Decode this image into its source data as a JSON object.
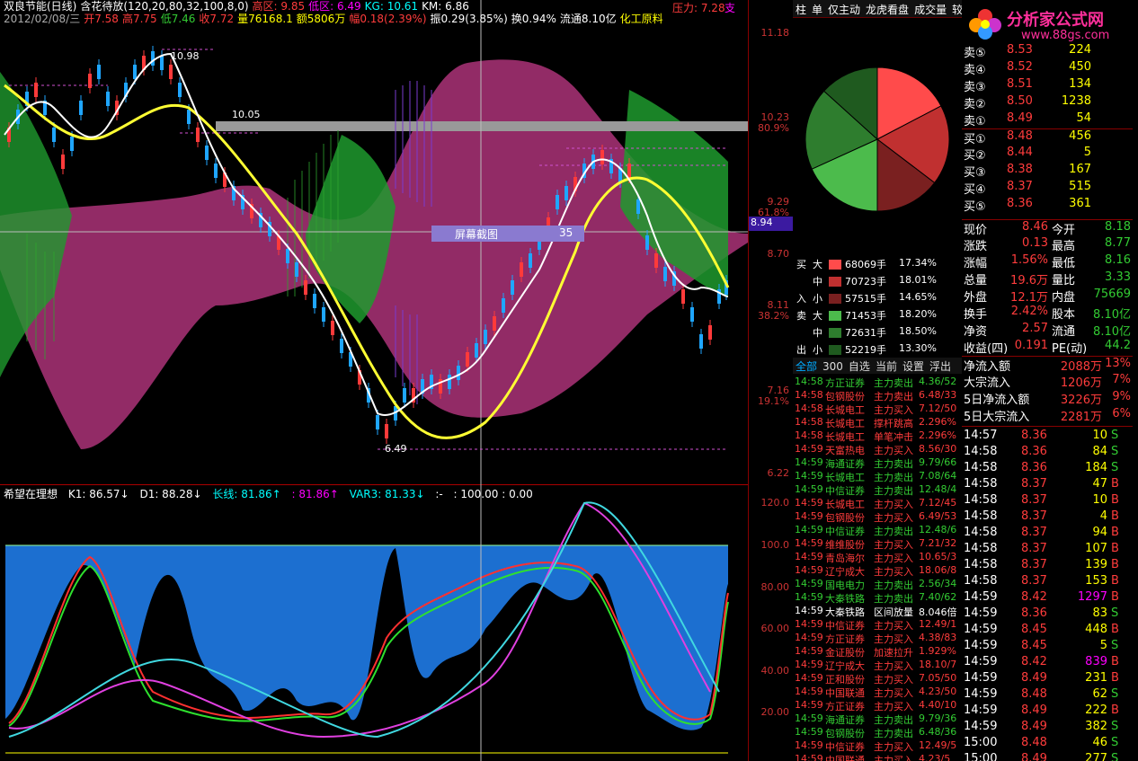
{
  "header": {
    "stock_name": "双良节能(日线)",
    "indicator": "含花待放(120,20,80,32,100,8,0)",
    "high_zone": "高区: 9.85",
    "low_zone": "低区: 6.49",
    "kg": "KG: 10.61",
    "km": "KM: 6.86",
    "pressure": "压力: 7.28",
    "support": "支",
    "date": "2012/02/08/三",
    "open": "开7.58",
    "high": "高7.75",
    "low": "低7.46",
    "close": "收7.72",
    "volume": "量76168.1",
    "amount": "额5806万",
    "amp": "幅0.18(2.39%)",
    "swing": "振0.29(3.85%)",
    "turnover": "换0.94%",
    "float": "流通8.10亿",
    "sector": "化工原料"
  },
  "chart_labels": {
    "max_label": "10.98",
    "min_label": "6.49",
    "level_label": "10.05",
    "overlay_box": "屏幕截图",
    "overlay_num": "35",
    "cursor_price": "8.94"
  },
  "price_axis": [
    "11.18",
    "10.23",
    "80.9%",
    "9.29",
    "61.8%",
    "8.70",
    "8.11",
    "38.2%",
    "7.16",
    "19.1%",
    "6.22"
  ],
  "sub_header": {
    "name": "希望在理想",
    "k1": "K1: 86.57↓",
    "d1": "D1: 88.28↓",
    "long": "长线: 81.86↑",
    "long2": ": 81.86↑",
    "var3": "VAR3: 81.33↓",
    "dash": ":-",
    "vals": ": 100.00 : 0.00"
  },
  "sub_axis": [
    "120.0",
    "100.0",
    "80.00",
    "60.00",
    "40.00",
    "20.00"
  ],
  "tabs": [
    "柱",
    "单",
    "仅主动",
    "龙虎看盘",
    "成交量",
    "较"
  ],
  "logo": {
    "title": "分析家公式网",
    "url": "www.88gs.com"
  },
  "pie_colors": [
    "#ff4b4b",
    "#c03030",
    "#7a2020",
    "#1f5a1f",
    "#2e7d2e",
    "#4cbb4c"
  ],
  "flow": [
    {
      "side": "买",
      "size": "大",
      "vol": "68069手",
      "pct": "17.34%",
      "color": "#ff4b4b"
    },
    {
      "side": "",
      "size": "中",
      "vol": "70723手",
      "pct": "18.01%",
      "color": "#c03030"
    },
    {
      "side": "入",
      "size": "小",
      "vol": "57515手",
      "pct": "14.65%",
      "color": "#7a2020"
    },
    {
      "side": "卖",
      "size": "大",
      "vol": "71453手",
      "pct": "18.20%",
      "color": "#4cbb4c"
    },
    {
      "side": "",
      "size": "中",
      "vol": "72631手",
      "pct": "18.50%",
      "color": "#2e7d2e"
    },
    {
      "side": "出",
      "size": "小",
      "vol": "52219手",
      "pct": "13.30%",
      "color": "#1f5a1f"
    }
  ],
  "list_tabs": [
    "全部",
    "300",
    "自选",
    "当前",
    "设置",
    "浮出"
  ],
  "ticks": [
    {
      "t": "14:58",
      "n": "方正证券",
      "a": "主力卖出",
      "v": "4.36/52",
      "c": "green"
    },
    {
      "t": "14:58",
      "n": "包钢股份",
      "a": "主力卖出",
      "v": "6.48/33",
      "c": "red"
    },
    {
      "t": "14:58",
      "n": "长城电工",
      "a": "主力买入",
      "v": "7.12/50",
      "c": "red"
    },
    {
      "t": "14:58",
      "n": "长城电工",
      "a": "撑杆跳高",
      "v": "2.296%",
      "c": "red"
    },
    {
      "t": "14:58",
      "n": "长城电工",
      "a": "单笔冲击",
      "v": "2.296%",
      "c": "red"
    },
    {
      "t": "14:59",
      "n": "天富热电",
      "a": "主力买入",
      "v": "8.56/30",
      "c": "red"
    },
    {
      "t": "14:59",
      "n": "海通证券",
      "a": "主力卖出",
      "v": "9.79/66",
      "c": "green"
    },
    {
      "t": "14:59",
      "n": "长城电工",
      "a": "主力卖出",
      "v": "7.08/64",
      "c": "green"
    },
    {
      "t": "14:59",
      "n": "中信证券",
      "a": "主力卖出",
      "v": "12.48/4",
      "c": "green"
    },
    {
      "t": "14:59",
      "n": "长城电工",
      "a": "主力买入",
      "v": "7.12/45",
      "c": "red"
    },
    {
      "t": "14:59",
      "n": "包钢股份",
      "a": "主力买入",
      "v": "6.49/53",
      "c": "red"
    },
    {
      "t": "14:59",
      "n": "中信证券",
      "a": "主力卖出",
      "v": "12.48/6",
      "c": "green"
    },
    {
      "t": "14:59",
      "n": "维维股份",
      "a": "主力买入",
      "v": "7.21/32",
      "c": "red"
    },
    {
      "t": "14:59",
      "n": "青岛海尔",
      "a": "主力买入",
      "v": "10.65/3",
      "c": "red"
    },
    {
      "t": "14:59",
      "n": "辽宁成大",
      "a": "主力买入",
      "v": "18.06/8",
      "c": "red"
    },
    {
      "t": "14:59",
      "n": "国电电力",
      "a": "主力卖出",
      "v": "2.56/34",
      "c": "green"
    },
    {
      "t": "14:59",
      "n": "大秦铁路",
      "a": "主力卖出",
      "v": "7.40/62",
      "c": "green"
    },
    {
      "t": "14:59",
      "n": "大秦铁路",
      "a": "区间放量",
      "v": "8.046倍",
      "c": "white"
    },
    {
      "t": "14:59",
      "n": "中信证券",
      "a": "主力买入",
      "v": "12.49/1",
      "c": "red"
    },
    {
      "t": "14:59",
      "n": "方正证券",
      "a": "主力买入",
      "v": "4.38/83",
      "c": "red"
    },
    {
      "t": "14:59",
      "n": "金证股份",
      "a": "加速拉升",
      "v": "1.929%",
      "c": "red"
    },
    {
      "t": "14:59",
      "n": "辽宁成大",
      "a": "主力买入",
      "v": "18.10/7",
      "c": "red"
    },
    {
      "t": "14:59",
      "n": "正和股份",
      "a": "主力买入",
      "v": "7.05/50",
      "c": "red"
    },
    {
      "t": "14:59",
      "n": "中国联通",
      "a": "主力买入",
      "v": "4.23/50",
      "c": "red"
    },
    {
      "t": "14:59",
      "n": "方正证券",
      "a": "主力买入",
      "v": "4.40/10",
      "c": "red"
    },
    {
      "t": "14:59",
      "n": "海通证券",
      "a": "主力卖出",
      "v": "9.79/36",
      "c": "green"
    },
    {
      "t": "14:59",
      "n": "包钢股份",
      "a": "主力卖出",
      "v": "6.48/36",
      "c": "green"
    },
    {
      "t": "14:59",
      "n": "中信证券",
      "a": "主力买入",
      "v": "12.49/5",
      "c": "red"
    },
    {
      "t": "14:59",
      "n": "中国联通",
      "a": "主力买入",
      "v": "4.23/5",
      "c": "red"
    }
  ],
  "order_book": [
    {
      "l": "卖⑤",
      "p": "8.53",
      "v": "224"
    },
    {
      "l": "卖④",
      "p": "8.52",
      "v": "450"
    },
    {
      "l": "卖③",
      "p": "8.51",
      "v": "134"
    },
    {
      "l": "卖②",
      "p": "8.50",
      "v": "1238"
    },
    {
      "l": "卖①",
      "p": "8.49",
      "v": "54"
    },
    {
      "l": "买①",
      "p": "8.48",
      "v": "456"
    },
    {
      "l": "买②",
      "p": "8.44",
      "v": "5"
    },
    {
      "l": "买③",
      "p": "8.38",
      "v": "167"
    },
    {
      "l": "买④",
      "p": "8.37",
      "v": "515"
    },
    {
      "l": "买⑤",
      "p": "8.36",
      "v": "361"
    }
  ],
  "stats": [
    {
      "l": "现价",
      "v": "8.46",
      "l2": "今开",
      "v2": "8.18"
    },
    {
      "l": "涨跌",
      "v": "0.13",
      "l2": "最高",
      "v2": "8.77"
    },
    {
      "l": "涨幅",
      "v": "1.56%",
      "l2": "最低",
      "v2": "8.16"
    },
    {
      "l": "总量",
      "v": "19.6万",
      "l2": "量比",
      "v2": "3.33"
    },
    {
      "l": "外盘",
      "v": "12.1万",
      "l2": "内盘",
      "v2": "75669"
    },
    {
      "l": "换手",
      "v": "2.42%",
      "l2": "股本",
      "v2": "8.10亿"
    },
    {
      "l": "净资",
      "v": "2.57",
      "l2": "流通",
      "v2": "8.10亿"
    },
    {
      "l": "收益(四)",
      "v": "0.191",
      "l2": "PE(动)",
      "v2": "44.2"
    }
  ],
  "fund_flow": [
    {
      "l": "净流入额",
      "v": "2088万",
      "p": "13%"
    },
    {
      "l": "大宗流入",
      "v": "1206万",
      "p": "7%"
    },
    {
      "l": "5日净流入额",
      "v": "3226万",
      "p": "9%"
    },
    {
      "l": "5日大宗流入",
      "v": "2281万",
      "p": "6%"
    }
  ],
  "trades": [
    {
      "t": "14:57",
      "p": "8.36",
      "v": "10",
      "s": "S"
    },
    {
      "t": "14:58",
      "p": "8.36",
      "v": "84",
      "s": "S"
    },
    {
      "t": "14:58",
      "p": "8.36",
      "v": "184",
      "s": "S"
    },
    {
      "t": "14:58",
      "p": "8.37",
      "v": "47",
      "s": "B"
    },
    {
      "t": "14:58",
      "p": "8.37",
      "v": "10",
      "s": "B"
    },
    {
      "t": "14:58",
      "p": "8.37",
      "v": "4",
      "s": "B"
    },
    {
      "t": "14:58",
      "p": "8.37",
      "v": "94",
      "s": "B"
    },
    {
      "t": "14:58",
      "p": "8.37",
      "v": "107",
      "s": "B"
    },
    {
      "t": "14:58",
      "p": "8.37",
      "v": "139",
      "s": "B"
    },
    {
      "t": "14:58",
      "p": "8.37",
      "v": "153",
      "s": "B"
    },
    {
      "t": "14:59",
      "p": "8.42",
      "v": "1297",
      "s": "B"
    },
    {
      "t": "14:59",
      "p": "8.36",
      "v": "83",
      "s": "S"
    },
    {
      "t": "14:59",
      "p": "8.45",
      "v": "448",
      "s": "B"
    },
    {
      "t": "14:59",
      "p": "8.45",
      "v": "5",
      "s": "S"
    },
    {
      "t": "14:59",
      "p": "8.42",
      "v": "839",
      "s": "B"
    },
    {
      "t": "14:59",
      "p": "8.49",
      "v": "231",
      "s": "B"
    },
    {
      "t": "14:59",
      "p": "8.48",
      "v": "62",
      "s": "S"
    },
    {
      "t": "14:59",
      "p": "8.49",
      "v": "222",
      "s": "B"
    },
    {
      "t": "14:59",
      "p": "8.49",
      "v": "382",
      "s": "S"
    },
    {
      "t": "15:00",
      "p": "8.48",
      "v": "46",
      "s": "S"
    },
    {
      "t": "15:00",
      "p": "8.49",
      "v": "277",
      "s": "S"
    }
  ]
}
